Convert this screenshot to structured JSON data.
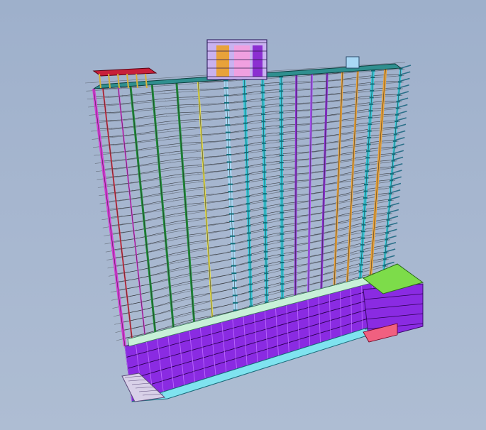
{
  "viewport": {
    "background_top": "#9eb0cb",
    "background_bottom": "#aebdd3"
  },
  "model": {
    "storeys": 32,
    "podium_storeys": 5,
    "wireframe_color": "#1a1a1a"
  },
  "colors": {
    "column_magenta": "#d63cd6",
    "column_green": "#1f8f3a",
    "column_yellow": "#e8e04a",
    "column_orange": "#e8a23a",
    "column_cyan": "#36c8d8",
    "column_purple": "#8b2fd1",
    "column_violet": "#a855f7",
    "column_red": "#e0344a",
    "column_lightblue": "#a9d8f5",
    "podium_purple": "#8a2be2",
    "podium_cyan": "#7fe3ef",
    "roof_teal": "#2f8f8f",
    "roof_green": "#7ddc4a",
    "roof_red": "#c8203a"
  },
  "icons": {
    "building": "building-wireframe-icon"
  }
}
